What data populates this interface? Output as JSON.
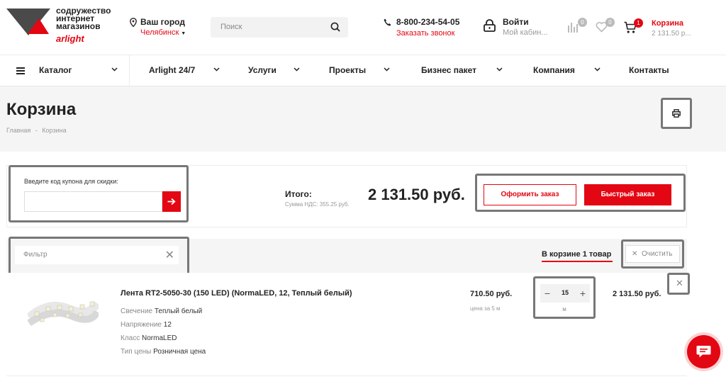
{
  "header": {
    "logo": {
      "line1": "содружество",
      "line2": "интернет",
      "line3": "магазинов",
      "brand": "arlight"
    },
    "city": {
      "label": "Ваш город",
      "value": "Челябинск"
    },
    "search": {
      "placeholder": "Поиск"
    },
    "phone": {
      "number": "8-800-234-54-05",
      "callback": "Заказать звонок"
    },
    "login": {
      "title": "Войти",
      "subtitle": "Мой кабин..."
    },
    "compare": {
      "count": "0"
    },
    "favorites": {
      "count": "0"
    },
    "cart": {
      "count": "1",
      "label": "Корзина",
      "total": "2 131.50 р..."
    }
  },
  "nav": {
    "items": [
      {
        "label": "Каталог"
      },
      {
        "label": "Arlight 24/7"
      },
      {
        "label": "Услуги"
      },
      {
        "label": "Проекты"
      },
      {
        "label": "Бизнес пакет"
      },
      {
        "label": "Компания"
      },
      {
        "label": "Контакты"
      }
    ]
  },
  "page": {
    "title": "Корзина",
    "breadcrumb": [
      "Главная",
      "Корзина"
    ],
    "breadcrumb_sep": "-"
  },
  "summary": {
    "coupon_label": "Введите код купона для скидки:",
    "coupon_value": "",
    "total_label": "Итого:",
    "vat_label": "Сумма НДС: 355.25 руб.",
    "total_value": "2 131.50 руб.",
    "order_button": "Оформить заказ",
    "quick_order_button": "Быстрый заказ"
  },
  "filter": {
    "placeholder": "Фильтр",
    "cart_count": "В корзине 1 товар",
    "clear_button": "Очистить"
  },
  "items": [
    {
      "name": "Лента RT2-5050-30 (150 LED) (NormaLED, 12, Теплый белый)",
      "props": [
        {
          "key": "Свечение",
          "value": "Теплый белый"
        },
        {
          "key": "Напряжение",
          "value": "12"
        },
        {
          "key": "Класс",
          "value": "NormaLED"
        },
        {
          "key": "Тип цены",
          "value": "Розничная цена"
        }
      ],
      "price": "710.50 руб.",
      "price_note": "цена за 5 м",
      "quantity": "15",
      "unit": "м",
      "total": "2 131.50 руб."
    }
  ],
  "colors": {
    "accent": "#e30613",
    "highlight_border": "#777777"
  }
}
